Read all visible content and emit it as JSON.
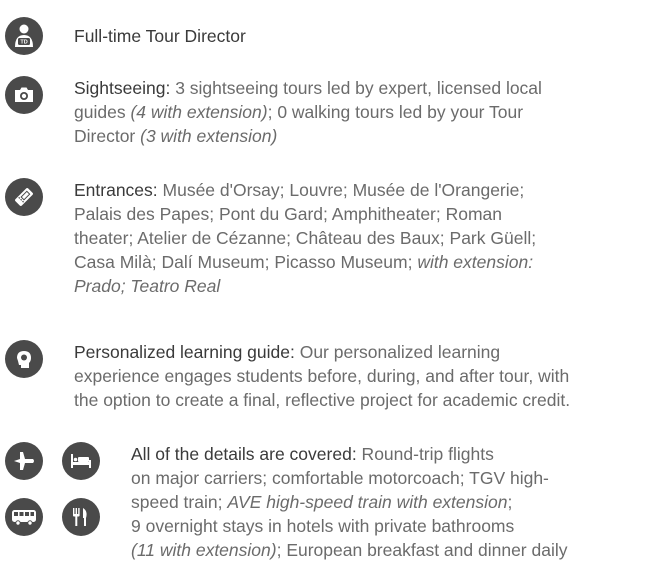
{
  "director": {
    "icon": "tour-director-badge-icon",
    "title": "Full-time Tour Director"
  },
  "sightseeing": {
    "icon": "camera-icon",
    "label": "Sightseeing:",
    "lines": [
      [
        {
          "t": " 3 sightseeing tours led by expert, licensed local",
          "i": false
        }
      ],
      [
        {
          "t": "guides ",
          "i": false
        },
        {
          "t": "(4 with extension)",
          "i": true
        },
        {
          "t": "; 0 walking tours led by your Tour",
          "i": false
        }
      ],
      [
        {
          "t": "Director ",
          "i": false
        },
        {
          "t": "(3 with extension)",
          "i": true
        }
      ]
    ]
  },
  "entrances": {
    "icon": "ticket-icon",
    "label": "Entrances:",
    "lines": [
      [
        {
          "t": " Musée d'Orsay; Louvre; Musée de l'Orangerie;",
          "i": false
        }
      ],
      [
        {
          "t": "Palais des Papes; Pont du Gard; Amphitheater; Roman",
          "i": false
        }
      ],
      [
        {
          "t": "theater; Atelier de Cézanne; Château des Baux; Park Güell;",
          "i": false
        }
      ],
      [
        {
          "t": "Casa Milà; Dalí Museum; Picasso Museum; ",
          "i": false
        },
        {
          "t": "with extension:",
          "i": true
        }
      ],
      [
        {
          "t": "Prado; Teatro Real",
          "i": true
        }
      ]
    ]
  },
  "learning": {
    "icon": "head-learning-icon",
    "label": "Personalized learning guide:",
    "lines": [
      [
        {
          "t": " Our personalized learning",
          "i": false
        }
      ],
      [
        {
          "t": "experience engages students before, during, and after tour, with",
          "i": false
        }
      ],
      [
        {
          "t": "the option to create a final, reflective project for academic credit.",
          "i": false
        }
      ]
    ]
  },
  "details": {
    "icons": [
      "airplane-icon",
      "bed-icon",
      "bus-icon",
      "fork-knife-icon"
    ],
    "label": "All of the details are covered:",
    "lines": [
      [
        {
          "t": " Round-trip flights",
          "i": false
        }
      ],
      [
        {
          "t": "on major carriers; comfortable motorcoach; TGV high-",
          "i": false
        }
      ],
      [
        {
          "t": "speed train; ",
          "i": false
        },
        {
          "t": "AVE high-speed train with extension",
          "i": true
        },
        {
          "t": ";",
          "i": false
        }
      ],
      [
        {
          "t": "9 overnight stays in hotels with private bathrooms",
          "i": false
        }
      ],
      [
        {
          "t": "(11 with extension)",
          "i": true
        },
        {
          "t": "; European breakfast and dinner daily",
          "i": false
        }
      ]
    ]
  }
}
